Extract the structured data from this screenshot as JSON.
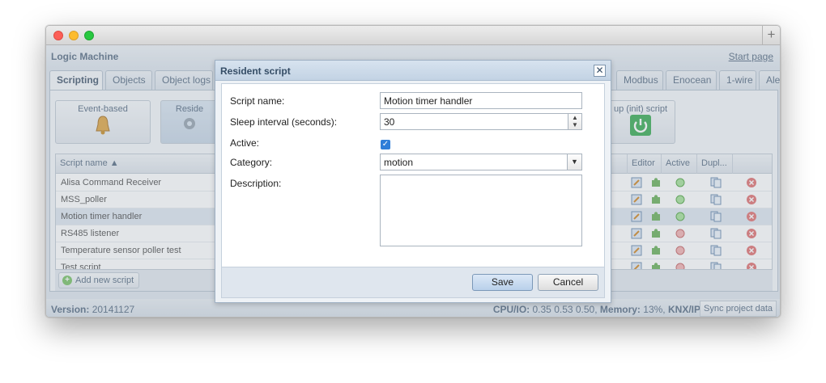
{
  "app": {
    "title": "Logic Machine",
    "start_page": "Start page"
  },
  "tabs": [
    {
      "label": "Scripting",
      "active": true
    },
    {
      "label": "Objects"
    },
    {
      "label": "Object logs"
    },
    {
      "label": "Modbus"
    },
    {
      "label": "Enocean"
    },
    {
      "label": "1-wire"
    },
    {
      "label": "Aler"
    }
  ],
  "script_types": {
    "event": "Event-based",
    "resident": "Reside",
    "startup": "up (init) script"
  },
  "grid": {
    "headers": {
      "name": "Script name ▲",
      "editor": "Editor",
      "active": "Active",
      "duplicate": "Dupl..."
    },
    "rows": [
      {
        "name": "Alisa Command Receiver",
        "active": true
      },
      {
        "name": "MSS_poller",
        "active": true
      },
      {
        "name": "Motion timer handler",
        "active": true
      },
      {
        "name": "RS485 listener",
        "active": false
      },
      {
        "name": "Temperature sensor poller test",
        "active": false
      },
      {
        "name": "Test script",
        "active": false
      }
    ],
    "add_label": "Add new script"
  },
  "status": {
    "version_label": "Version:",
    "version": "20141127",
    "cpu_label": "CPU/IO:",
    "cpu": "0.35 0.53 0.50,",
    "mem_label": "Memory:",
    "mem": "13%,",
    "knx": "KNX/IP",
    "sync": "Sync project data"
  },
  "dialog": {
    "title": "Resident script",
    "close": "✕",
    "labels": {
      "name": "Script name:",
      "sleep": "Sleep interval (seconds):",
      "active": "Active:",
      "category": "Category:",
      "description": "Description:"
    },
    "values": {
      "name": "Motion timer handler",
      "sleep": "30",
      "active": true,
      "category": "motion",
      "description": ""
    },
    "save": "Save",
    "cancel": "Cancel"
  },
  "colors": {
    "accent": "#5d7187",
    "dialog_title": "#354d66",
    "active_green": "#7cc36a",
    "inactive_red": "#e88a8a"
  }
}
